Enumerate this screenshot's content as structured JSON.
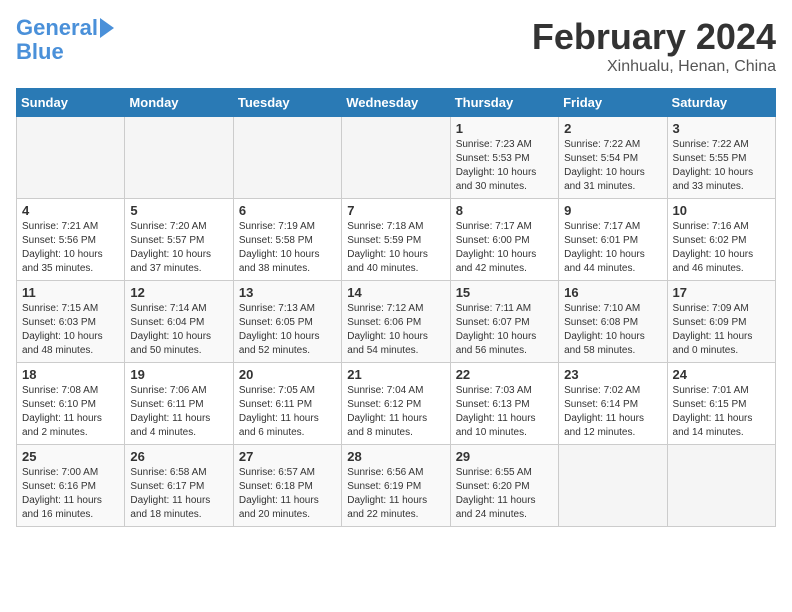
{
  "logo": {
    "line1": "General",
    "line2": "Blue"
  },
  "title": "February 2024",
  "subtitle": "Xinhualu, Henan, China",
  "weekdays": [
    "Sunday",
    "Monday",
    "Tuesday",
    "Wednesday",
    "Thursday",
    "Friday",
    "Saturday"
  ],
  "weeks": [
    [
      {
        "day": "",
        "info": ""
      },
      {
        "day": "",
        "info": ""
      },
      {
        "day": "",
        "info": ""
      },
      {
        "day": "",
        "info": ""
      },
      {
        "day": "1",
        "info": "Sunrise: 7:23 AM\nSunset: 5:53 PM\nDaylight: 10 hours\nand 30 minutes."
      },
      {
        "day": "2",
        "info": "Sunrise: 7:22 AM\nSunset: 5:54 PM\nDaylight: 10 hours\nand 31 minutes."
      },
      {
        "day": "3",
        "info": "Sunrise: 7:22 AM\nSunset: 5:55 PM\nDaylight: 10 hours\nand 33 minutes."
      }
    ],
    [
      {
        "day": "4",
        "info": "Sunrise: 7:21 AM\nSunset: 5:56 PM\nDaylight: 10 hours\nand 35 minutes."
      },
      {
        "day": "5",
        "info": "Sunrise: 7:20 AM\nSunset: 5:57 PM\nDaylight: 10 hours\nand 37 minutes."
      },
      {
        "day": "6",
        "info": "Sunrise: 7:19 AM\nSunset: 5:58 PM\nDaylight: 10 hours\nand 38 minutes."
      },
      {
        "day": "7",
        "info": "Sunrise: 7:18 AM\nSunset: 5:59 PM\nDaylight: 10 hours\nand 40 minutes."
      },
      {
        "day": "8",
        "info": "Sunrise: 7:17 AM\nSunset: 6:00 PM\nDaylight: 10 hours\nand 42 minutes."
      },
      {
        "day": "9",
        "info": "Sunrise: 7:17 AM\nSunset: 6:01 PM\nDaylight: 10 hours\nand 44 minutes."
      },
      {
        "day": "10",
        "info": "Sunrise: 7:16 AM\nSunset: 6:02 PM\nDaylight: 10 hours\nand 46 minutes."
      }
    ],
    [
      {
        "day": "11",
        "info": "Sunrise: 7:15 AM\nSunset: 6:03 PM\nDaylight: 10 hours\nand 48 minutes."
      },
      {
        "day": "12",
        "info": "Sunrise: 7:14 AM\nSunset: 6:04 PM\nDaylight: 10 hours\nand 50 minutes."
      },
      {
        "day": "13",
        "info": "Sunrise: 7:13 AM\nSunset: 6:05 PM\nDaylight: 10 hours\nand 52 minutes."
      },
      {
        "day": "14",
        "info": "Sunrise: 7:12 AM\nSunset: 6:06 PM\nDaylight: 10 hours\nand 54 minutes."
      },
      {
        "day": "15",
        "info": "Sunrise: 7:11 AM\nSunset: 6:07 PM\nDaylight: 10 hours\nand 56 minutes."
      },
      {
        "day": "16",
        "info": "Sunrise: 7:10 AM\nSunset: 6:08 PM\nDaylight: 10 hours\nand 58 minutes."
      },
      {
        "day": "17",
        "info": "Sunrise: 7:09 AM\nSunset: 6:09 PM\nDaylight: 11 hours\nand 0 minutes."
      }
    ],
    [
      {
        "day": "18",
        "info": "Sunrise: 7:08 AM\nSunset: 6:10 PM\nDaylight: 11 hours\nand 2 minutes."
      },
      {
        "day": "19",
        "info": "Sunrise: 7:06 AM\nSunset: 6:11 PM\nDaylight: 11 hours\nand 4 minutes."
      },
      {
        "day": "20",
        "info": "Sunrise: 7:05 AM\nSunset: 6:11 PM\nDaylight: 11 hours\nand 6 minutes."
      },
      {
        "day": "21",
        "info": "Sunrise: 7:04 AM\nSunset: 6:12 PM\nDaylight: 11 hours\nand 8 minutes."
      },
      {
        "day": "22",
        "info": "Sunrise: 7:03 AM\nSunset: 6:13 PM\nDaylight: 11 hours\nand 10 minutes."
      },
      {
        "day": "23",
        "info": "Sunrise: 7:02 AM\nSunset: 6:14 PM\nDaylight: 11 hours\nand 12 minutes."
      },
      {
        "day": "24",
        "info": "Sunrise: 7:01 AM\nSunset: 6:15 PM\nDaylight: 11 hours\nand 14 minutes."
      }
    ],
    [
      {
        "day": "25",
        "info": "Sunrise: 7:00 AM\nSunset: 6:16 PM\nDaylight: 11 hours\nand 16 minutes."
      },
      {
        "day": "26",
        "info": "Sunrise: 6:58 AM\nSunset: 6:17 PM\nDaylight: 11 hours\nand 18 minutes."
      },
      {
        "day": "27",
        "info": "Sunrise: 6:57 AM\nSunset: 6:18 PM\nDaylight: 11 hours\nand 20 minutes."
      },
      {
        "day": "28",
        "info": "Sunrise: 6:56 AM\nSunset: 6:19 PM\nDaylight: 11 hours\nand 22 minutes."
      },
      {
        "day": "29",
        "info": "Sunrise: 6:55 AM\nSunset: 6:20 PM\nDaylight: 11 hours\nand 24 minutes."
      },
      {
        "day": "",
        "info": ""
      },
      {
        "day": "",
        "info": ""
      }
    ]
  ]
}
